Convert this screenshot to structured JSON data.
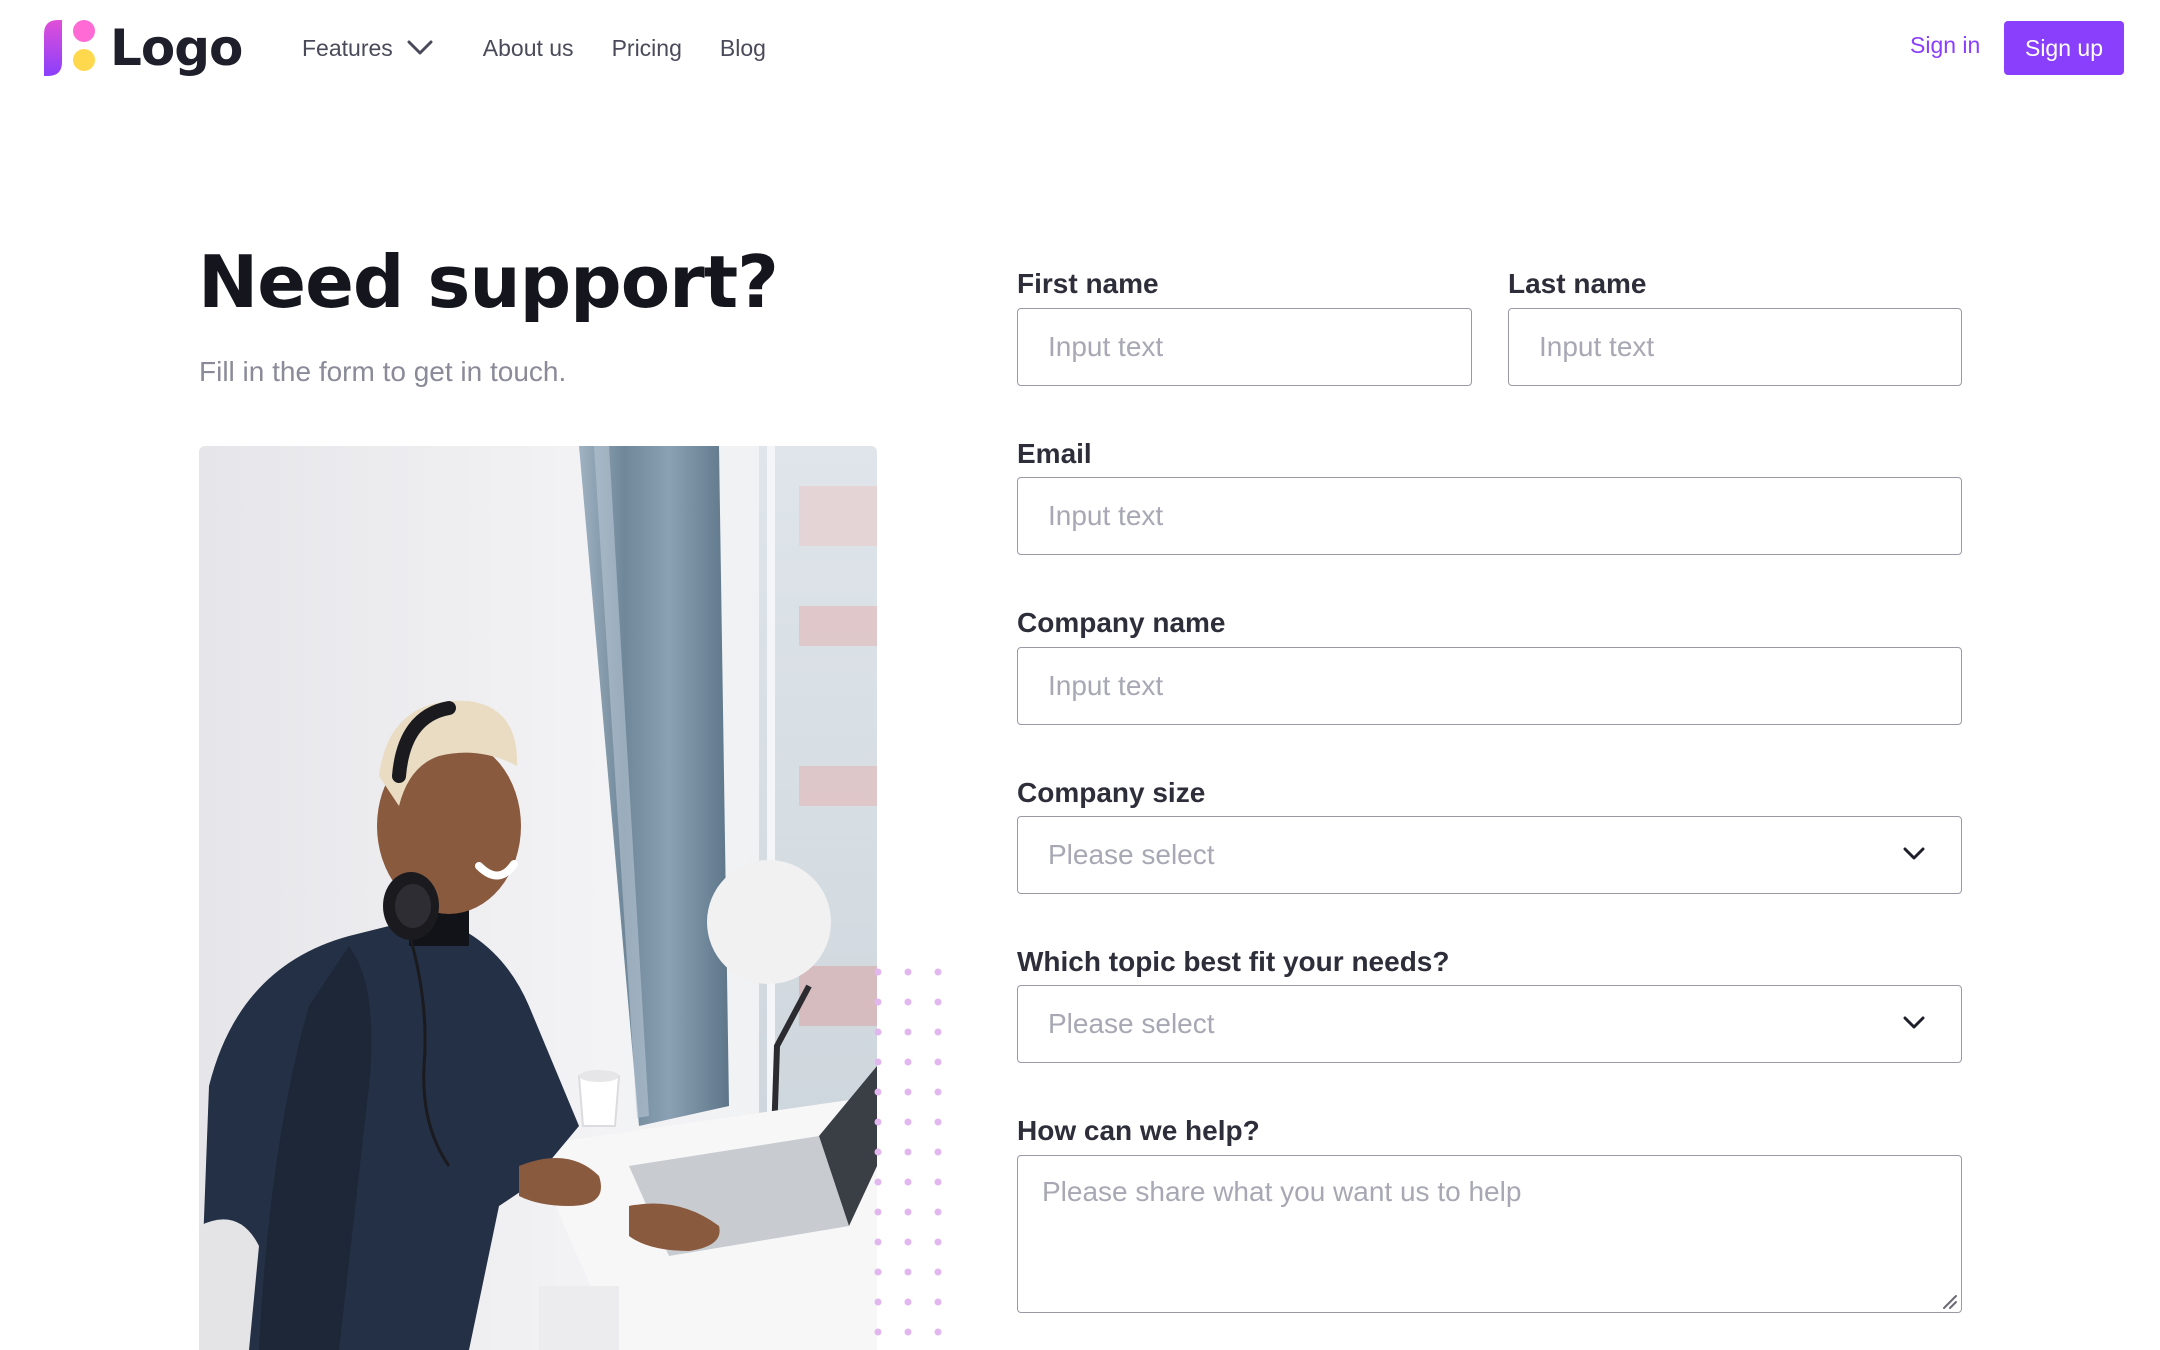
{
  "nav": {
    "logo_text": "Logo",
    "features_label": "Features",
    "about_label": "About us",
    "pricing_label": "Pricing",
    "blog_label": "Blog",
    "signin_label": "Sign in",
    "signup_label": "Sign up"
  },
  "hero": {
    "title": "Need support?",
    "subtitle": "Fill in the form to get in touch."
  },
  "form": {
    "first_name": {
      "label": "First name",
      "placeholder": "Input text"
    },
    "last_name": {
      "label": "Last name",
      "placeholder": "Input text"
    },
    "email": {
      "label": "Email",
      "placeholder": "Input text"
    },
    "company_name": {
      "label": "Company name",
      "placeholder": "Input text"
    },
    "company_size": {
      "label": "Company size",
      "value": "Please select"
    },
    "topic": {
      "label": "Which topic best fit your needs?",
      "value": "Please select"
    },
    "help": {
      "label": "How can we help?",
      "placeholder": "Please share what you want us to help"
    }
  },
  "colors": {
    "accent": "#8a3ffc",
    "logo_pink": "#ff6ad5",
    "logo_yellow": "#ffd84d",
    "heading": "#15151e",
    "muted": "#8a8a98",
    "border": "#9a9aa6"
  },
  "icons": {
    "features_chevron": "chevron-down-icon",
    "select_chevron": "chevron-down-icon",
    "textarea_resize": "resize-handle-icon"
  },
  "image": {
    "subject": "person-with-headphones-typing-on-laptop-photo"
  }
}
